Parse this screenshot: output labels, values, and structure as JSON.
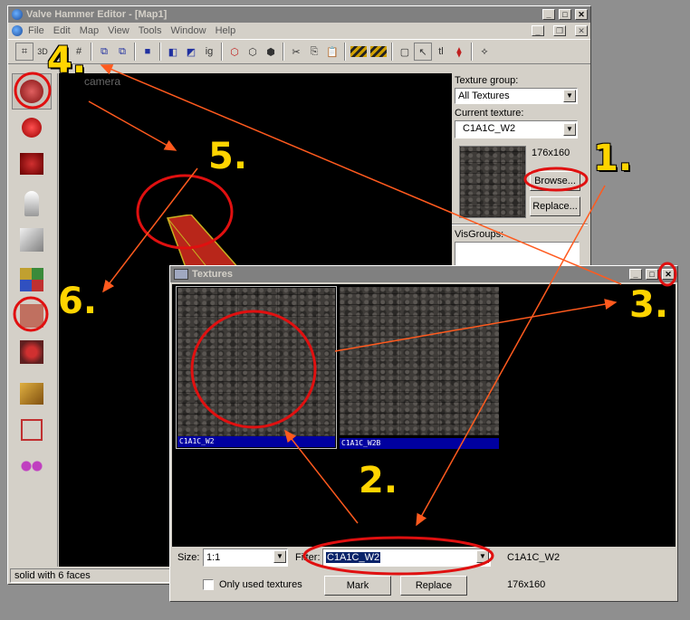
{
  "main_window": {
    "title": "Valve Hammer Editor - [Map1]",
    "menu": [
      "File",
      "Edit",
      "Map",
      "View",
      "Tools",
      "Window",
      "Help"
    ],
    "viewport_label": "camera",
    "status_text": "solid with 6 faces"
  },
  "toolbar": {
    "icons": [
      "grid-icon",
      "3d-grid-icon",
      "dot-grid-icon",
      "hash-icon",
      "copy-objects-icon",
      "paste-objects-icon",
      "group-icon",
      "carve-icon",
      "hollow-icon",
      "ig-icon",
      "cube-red-icon",
      "cube-outline-icon",
      "cube-dark-icon",
      "cut-icon",
      "copy-icon",
      "paste-icon",
      "texture-lock-icon",
      "no-lock-icon",
      "select-icon",
      "pointer-icon",
      "tl-icon",
      "decal-icon",
      "vertex-icon"
    ],
    "ig_label": "ig",
    "tl_label": "tl"
  },
  "texture_panel": {
    "group_label": "Texture group:",
    "group_value": "All Textures",
    "current_label": "Current texture:",
    "current_value": "C1A1C_W2",
    "size": "176x160",
    "browse_label": "Browse...",
    "replace_label": "Replace...",
    "visgroups_label": "VisGroups:"
  },
  "textures_dialog": {
    "title": "Textures",
    "items": [
      {
        "name": "C1A1C_W2"
      },
      {
        "name": "C1A1C_W2B"
      }
    ],
    "size_label": "Size:",
    "size_value": "1:1",
    "filter_label": "Filter:",
    "filter_value": "C1A1C_W2",
    "selected_name": "C1A1C_W2",
    "selected_size": "176x160",
    "only_used_label": "Only used textures",
    "mark_label": "Mark",
    "replace_label": "Replace"
  },
  "annotations": {
    "step_labels": [
      "1.",
      "2.",
      "3.",
      "4.",
      "5.",
      "6."
    ],
    "highlight_color": "#e01010",
    "arrow_color": "#ff5a1e",
    "label_color": "#ffd400"
  }
}
